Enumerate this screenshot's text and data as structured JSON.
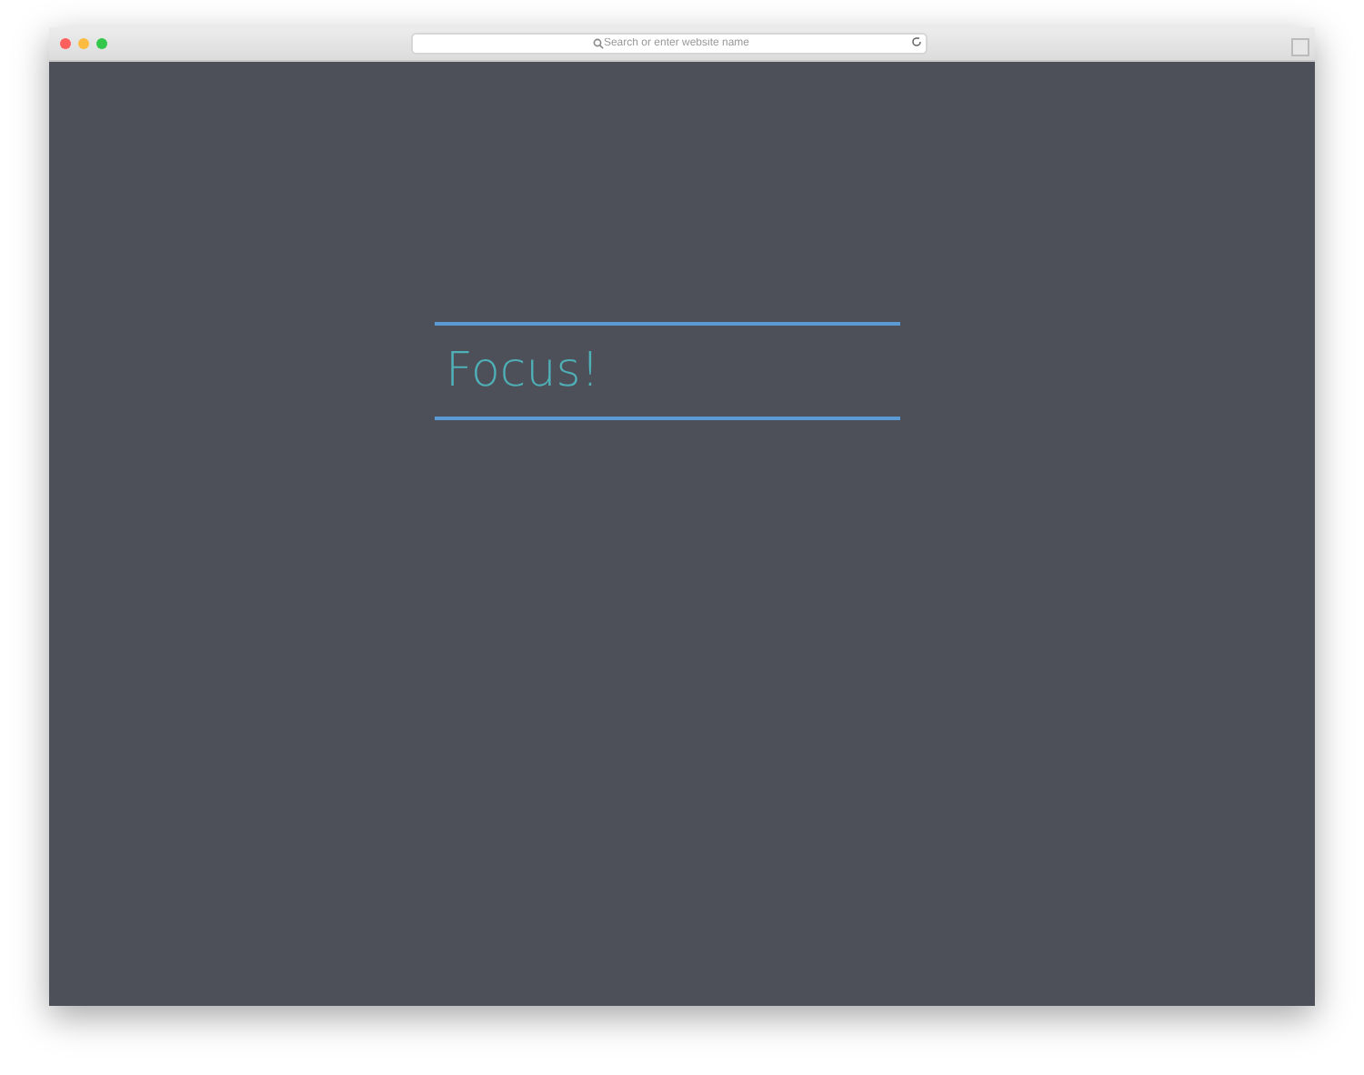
{
  "browser": {
    "address_placeholder": "Search or enter website name"
  },
  "field": {
    "value": "Focus!",
    "focused": true
  }
}
